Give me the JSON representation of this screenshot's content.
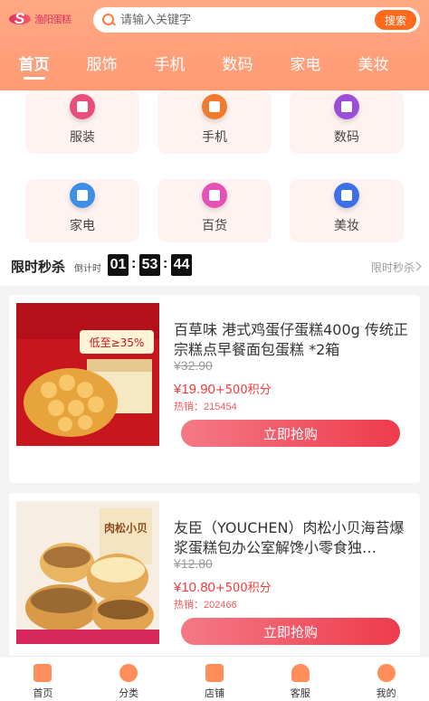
{
  "header": {
    "logo_text": "渔阳蛋糕",
    "search_placeholder": "请输入关键字",
    "search_button": "搜索",
    "tabs": [
      "首页",
      "服饰",
      "手机",
      "数码",
      "家电",
      "美妆"
    ]
  },
  "categories": [
    {
      "label": "服装",
      "icon": "shirt-icon",
      "color": "#e84e7b"
    },
    {
      "label": "手机",
      "icon": "phone-icon",
      "color": "#f07b2f"
    },
    {
      "label": "数码",
      "icon": "camera-icon",
      "color": "#9b4fd8"
    },
    {
      "label": "家电",
      "icon": "washing-machine-icon",
      "color": "#3c8ee6"
    },
    {
      "label": "百货",
      "icon": "tissue-icon",
      "color": "#e451b7"
    },
    {
      "label": "美妆",
      "icon": "makeup-icon",
      "color": "#3f6fe8"
    }
  ],
  "flash_sale": {
    "title": "限时秒杀",
    "countdown_label": "倒计时",
    "hours": "01",
    "minutes": "53",
    "seconds": "44",
    "more": "限时秒杀"
  },
  "products": [
    {
      "name": "百草味 港式鸡蛋仔蛋糕400g 传统正宗糕点早餐面包蛋糕 *2箱",
      "original_price": "¥32.90",
      "price": "¥19.90",
      "points": "+500积分",
      "sold": "热销：215454",
      "button": "立即抢购",
      "image_text": "低至≥35%"
    },
    {
      "name": "友臣（YOUCHEN）肉松小贝海苔爆浆蛋糕包办公室解馋小零食独…",
      "original_price": "¥12.80",
      "price": "¥10.80",
      "points": "+500积分",
      "sold": "热销：202466",
      "button": "立即抢购",
      "image_text": "肉松小贝"
    }
  ],
  "nav": [
    {
      "label": "首页",
      "icon": "home-icon"
    },
    {
      "label": "分类",
      "icon": "category-icon"
    },
    {
      "label": "店铺",
      "icon": "store-icon"
    },
    {
      "label": "客服",
      "icon": "service-icon"
    },
    {
      "label": "我的",
      "icon": "profile-icon"
    }
  ]
}
